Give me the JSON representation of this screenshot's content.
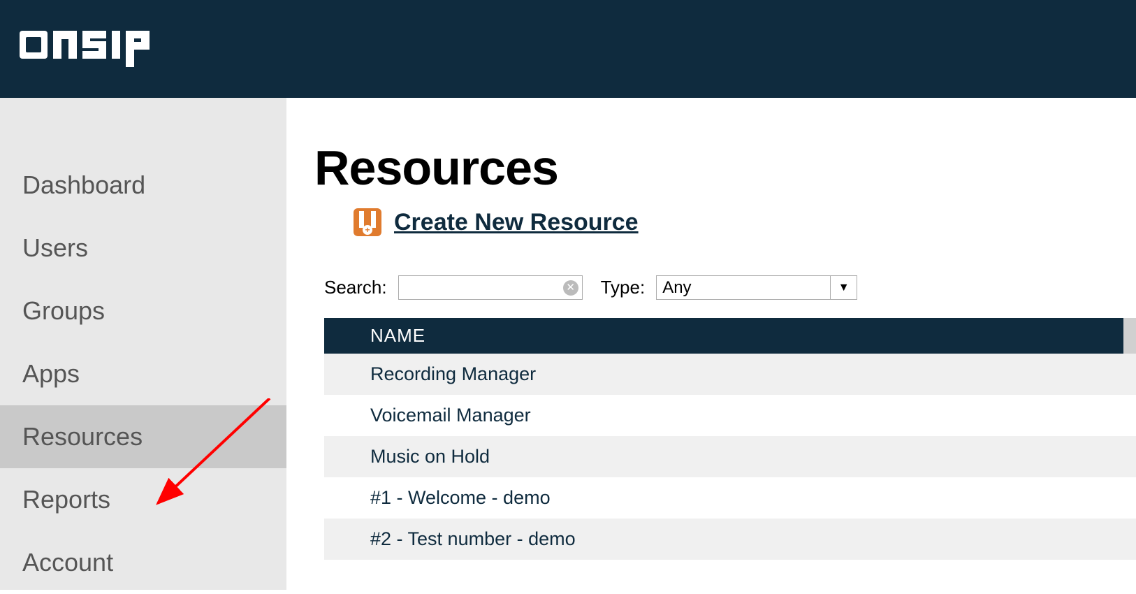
{
  "brand": "onsip",
  "sidebar": {
    "items": [
      {
        "label": "Dashboard",
        "active": false
      },
      {
        "label": "Users",
        "active": false
      },
      {
        "label": "Groups",
        "active": false
      },
      {
        "label": "Apps",
        "active": false
      },
      {
        "label": "Resources",
        "active": true
      },
      {
        "label": "Reports",
        "active": false
      },
      {
        "label": "Account",
        "active": false
      }
    ]
  },
  "main": {
    "title": "Resources",
    "create_label": "Create New Resource",
    "filters": {
      "search_label": "Search:",
      "search_value": "",
      "type_label": "Type:",
      "type_selected": "Any"
    },
    "table": {
      "header": "NAME",
      "rows": [
        "Recording Manager",
        "Voicemail Manager",
        "Music on Hold",
        "#1 - Welcome - demo",
        "#2 - Test number - demo"
      ]
    }
  }
}
